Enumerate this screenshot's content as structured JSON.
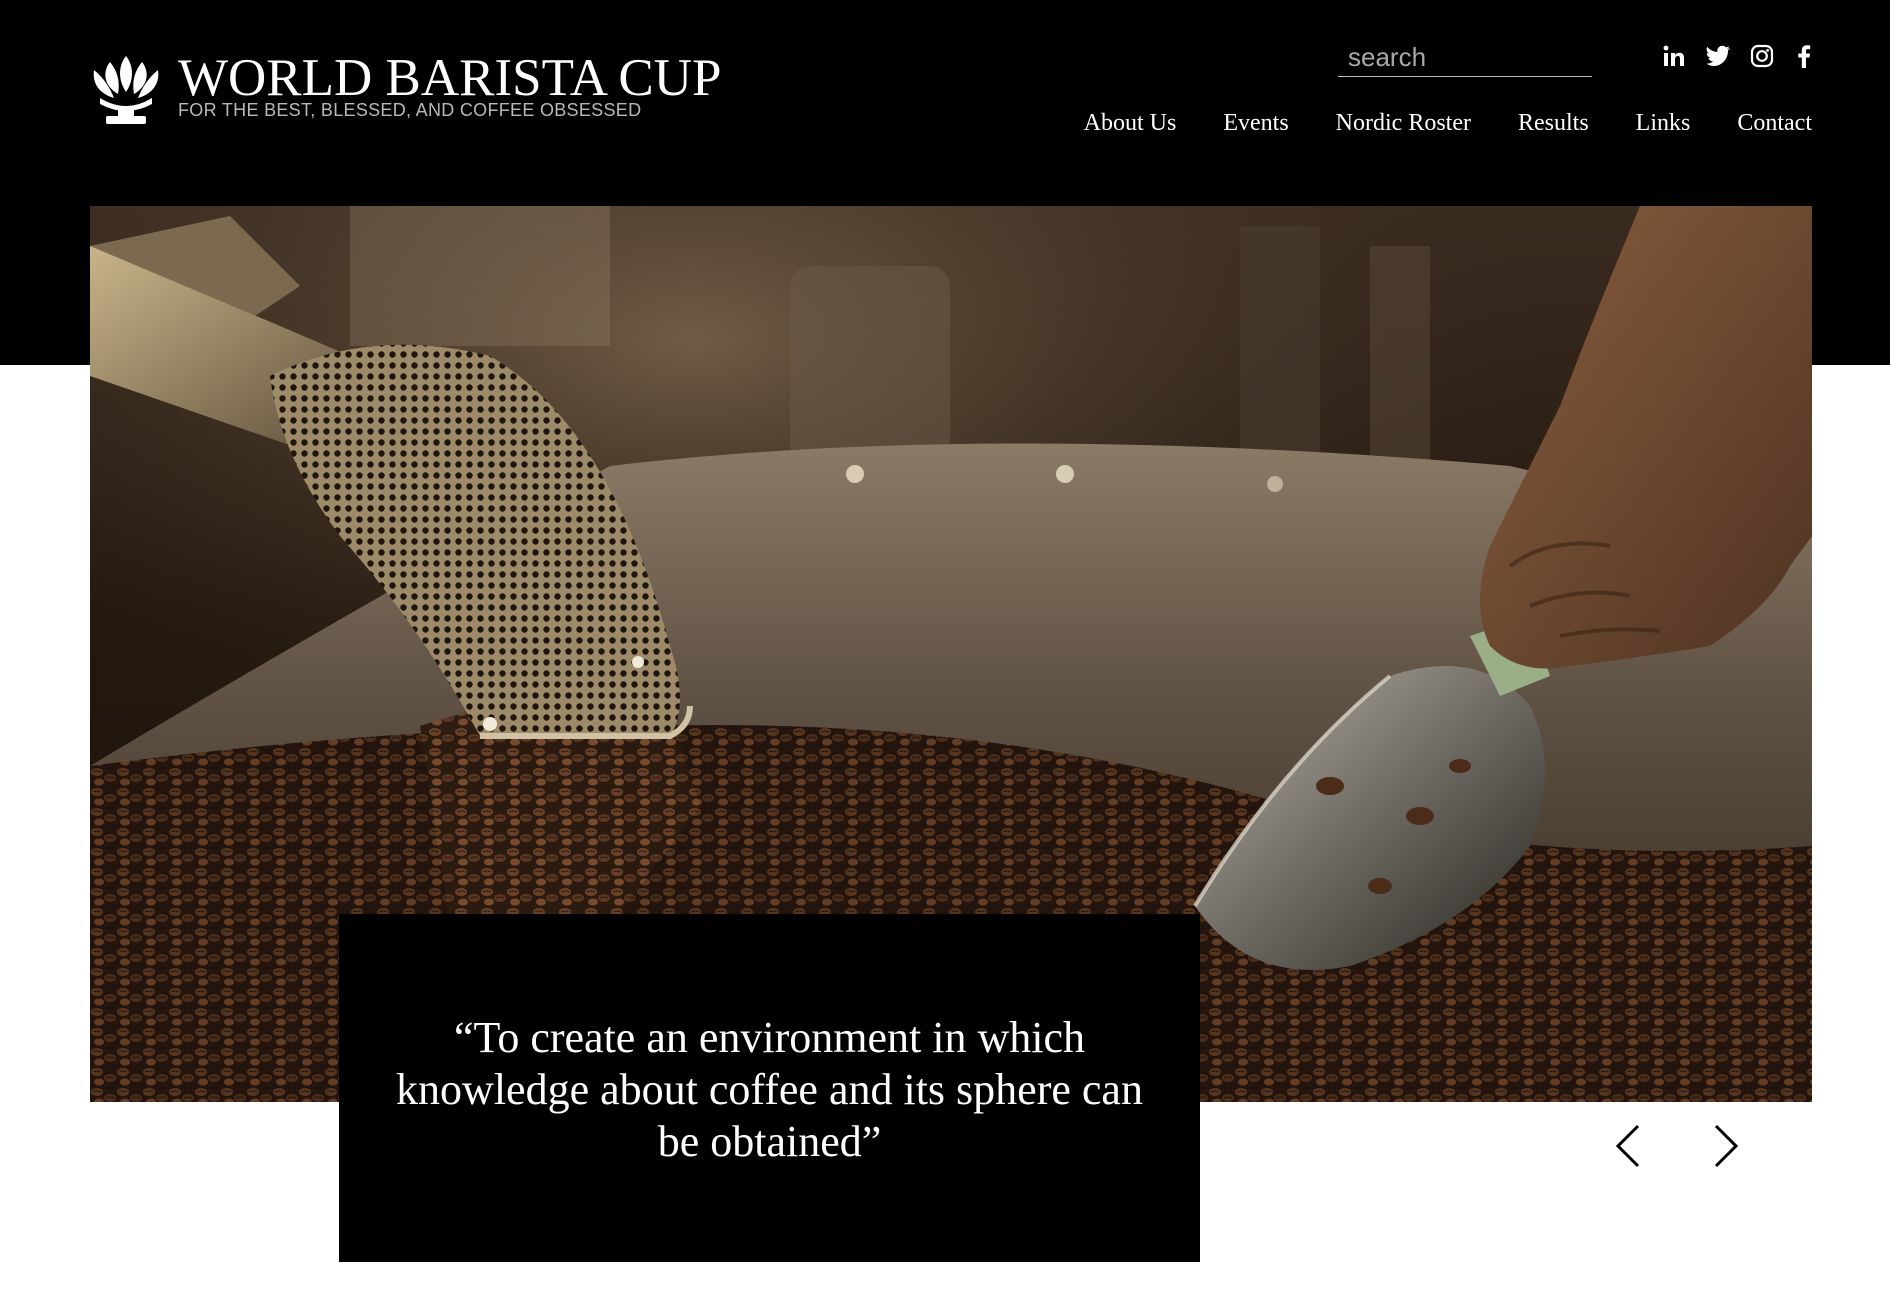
{
  "brand": {
    "title": "WORLD BARISTA CUP",
    "tagline": "FOR THE BEST, BLESSED, AND COFFEE OBSESSED",
    "logo_icon": "coffee-plant-icon"
  },
  "search": {
    "placeholder": "search",
    "value": "",
    "icon": "search-icon"
  },
  "social": [
    {
      "name": "linkedin",
      "icon": "linkedin-icon",
      "glyph": "in"
    },
    {
      "name": "twitter",
      "icon": "twitter-icon"
    },
    {
      "name": "instagram",
      "icon": "instagram-icon"
    },
    {
      "name": "facebook",
      "icon": "facebook-icon",
      "glyph": "f"
    }
  ],
  "nav": {
    "items": [
      {
        "label": "About Us"
      },
      {
        "label": "Events"
      },
      {
        "label": "Nordic Roster"
      },
      {
        "label": "Results"
      },
      {
        "label": "Links"
      },
      {
        "label": "Contact"
      }
    ]
  },
  "hero": {
    "image": "coffee-roaster-beans-photo",
    "quote": "“To create an environment in which knowledge about coffee and its sphere can be obtained”",
    "prev_icon": "chevron-left-icon",
    "next_icon": "chevron-right-icon"
  },
  "colors": {
    "header_bg": "#000000",
    "page_bg": "#ffffff",
    "text_light": "#ffffff",
    "tagline": "#b8b8b8"
  }
}
